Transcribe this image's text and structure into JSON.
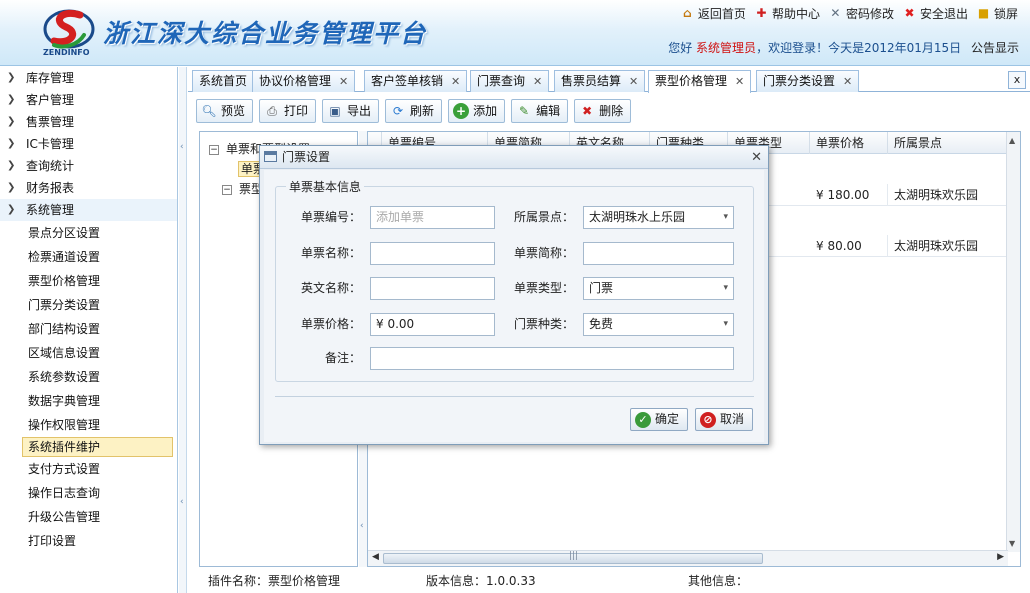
{
  "app": {
    "logo_text": "ZENDINFO",
    "title": "浙江深大综合业务管理平台"
  },
  "topnav": {
    "home": "返回首页",
    "help": "帮助中心",
    "password": "密码修改",
    "logout": "安全退出",
    "lock": "锁屏"
  },
  "welcome": {
    "prefix": "您好",
    "user": "系统管理员",
    "suffix": "，欢迎登录！今天是2012年01月15日",
    "notice": "公告显示"
  },
  "sidebar": {
    "menus": [
      "库存管理",
      "客户管理",
      "售票管理",
      "IC卡管理",
      "查询统计",
      "财务报表"
    ],
    "open_menu": "系统管理",
    "sub_items": [
      "景点分区设置",
      "检票通道设置",
      "票型价格管理",
      "门票分类设置",
      "部门结构设置",
      "区域信息设置",
      "系统参数设置",
      "数据字典管理",
      "操作权限管理",
      "系统插件维护",
      "支付方式设置",
      "操作日志查询",
      "升级公告管理",
      "打印设置"
    ],
    "active_sub": "系统插件维护"
  },
  "tabs": [
    {
      "label": "系统首页",
      "closable": false
    },
    {
      "label": "协议价格管理",
      "closable": true
    },
    {
      "label": "客户签单核销",
      "closable": true
    },
    {
      "label": "门票查询",
      "closable": true
    },
    {
      "label": "售票员结算",
      "closable": true
    },
    {
      "label": "票型价格管理",
      "closable": true,
      "active": true
    },
    {
      "label": "门票分类设置",
      "closable": true
    }
  ],
  "toolbar": {
    "preview": "预览",
    "print": "打印",
    "export": "导出",
    "refresh": "刷新",
    "add": "添加",
    "edit": "编辑",
    "delete": "删除"
  },
  "tree": {
    "node1": "单票和票型设置",
    "node1_child": "单票",
    "node2": "票型"
  },
  "grid": {
    "columns": [
      "单票编号",
      "单票简称",
      "英文名称",
      "门票种类",
      "单票类型",
      "单票价格",
      "所属景点"
    ],
    "rows": [
      {
        "price": "¥ 180.00",
        "spot": "太湖明珠欢乐园"
      },
      {
        "price": "¥ 80.00",
        "spot": "太湖明珠欢乐园"
      }
    ]
  },
  "status": {
    "plugin": "插件名称：票型价格管理",
    "version": "版本信息：1.0.0.33",
    "other": "其他信息："
  },
  "modal": {
    "title": "门票设置",
    "legend": "单票基本信息",
    "labels": {
      "ticket_no": "单票编号：",
      "spot": "所属景点：",
      "name": "单票名称：",
      "short_name": "单票简称：",
      "english": "英文名称：",
      "type": "单票类型：",
      "price": "单票价格：",
      "kind": "门票种类：",
      "remark": "备注："
    },
    "values": {
      "ticket_no_placeholder": "添加单票",
      "spot": "太湖明珠水上乐园",
      "name": "",
      "short_name": "",
      "english": "",
      "type": "门票",
      "price": "¥ 0.00",
      "kind": "免费",
      "remark": ""
    },
    "ok": "确定",
    "cancel": "取消"
  }
}
